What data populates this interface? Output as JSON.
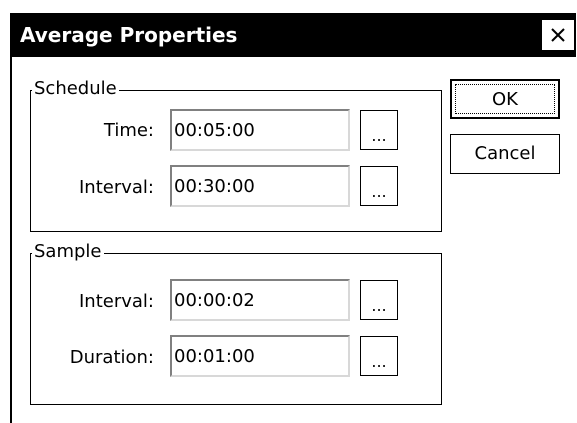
{
  "dialog": {
    "title": "Average Properties",
    "close_glyph": "×",
    "ok_label": "OK",
    "cancel_label": "Cancel"
  },
  "schedule": {
    "legend": "Schedule",
    "time_label": "Time:",
    "time_value": "00:05:00",
    "interval_label": "Interval:",
    "interval_value": "00:30:00"
  },
  "sample": {
    "legend": "Sample",
    "interval_label": "Interval:",
    "interval_value": "00:00:02",
    "duration_label": "Duration:",
    "duration_value": "00:01:00"
  },
  "browse_label": "...",
  "icons": {
    "close": "close-icon"
  }
}
